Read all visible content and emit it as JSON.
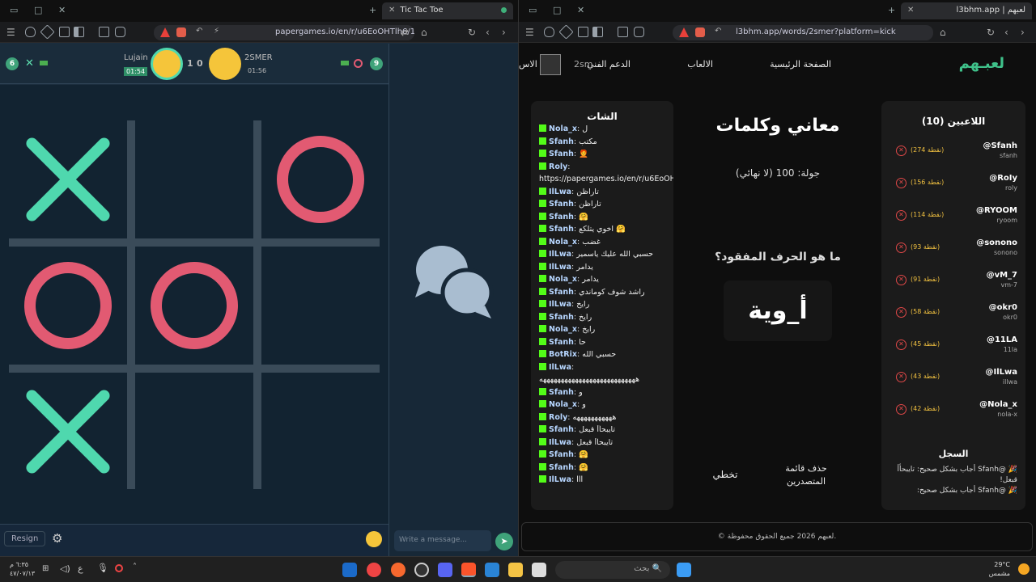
{
  "left_window": {
    "tab_title": "Tic Tac Toe",
    "url": "papergames.io/en/r/u6EoOHTlh6/1",
    "players": {
      "left_name": "Lujain",
      "left_timer": "01:54",
      "left_score": "1",
      "right_name": "2SMER",
      "right_timer": "01:56",
      "right_score": "0",
      "left_badge": "6",
      "right_badge": "9"
    },
    "board": [
      "X",
      "",
      "O",
      "O",
      "O",
      "",
      "X",
      "",
      ""
    ],
    "resign_label": "Resign",
    "chat_placeholder": "Write a message..."
  },
  "right_window": {
    "tab_title": "l3bhm.app | لعبهم",
    "url": "l3bhm.app/words/2smer?platform=kick",
    "logo": "لعبـهم",
    "nav": [
      "الصفحة الرئيسية",
      "الالعاب",
      "الدعم الفني",
      "2sm",
      "الاس"
    ],
    "chat_title": "الشات",
    "chat": [
      {
        "u": "Nola_x",
        "m": "ل"
      },
      {
        "u": "Sfanh",
        "m": "مكتب"
      },
      {
        "u": "Sfanh",
        "m": "🧑‍🦰"
      },
      {
        "u": "Roly",
        "m": ""
      },
      {
        "u": "",
        "m": "https://papergames.io/en/r/u6EoOH"
      },
      {
        "u": "IlLwa",
        "m": "تاراظن"
      },
      {
        "u": "Sfanh",
        "m": "تاراظن"
      },
      {
        "u": "Sfanh",
        "m": "🤗"
      },
      {
        "u": "Sfanh",
        "m": "اخوي يتلكع 🤗"
      },
      {
        "u": "Nola_x",
        "m": "غضب"
      },
      {
        "u": "IlLwa",
        "m": "حسبي الله عليك ياسمير"
      },
      {
        "u": "IlLwa",
        "m": "يدامر"
      },
      {
        "u": "Nola_x",
        "m": "يدامر"
      },
      {
        "u": "Sfanh",
        "m": "راشد شوف كوماندي"
      },
      {
        "u": "IlLwa",
        "m": "رايخ"
      },
      {
        "u": "Sfanh",
        "m": "رايخ"
      },
      {
        "u": "Nola_x",
        "m": "رايخ"
      },
      {
        "u": "Sfanh",
        "m": "حا"
      },
      {
        "u": "BotRix",
        "m": "حسبي الله"
      },
      {
        "u": "IlLwa",
        "m": ""
      },
      {
        "u": "",
        "m": "هههههههههههههههههههههههههههه"
      },
      {
        "u": "Sfanh",
        "m": "و"
      },
      {
        "u": "Nola_x",
        "m": "و"
      },
      {
        "u": "Roly",
        "m": "هههههههههههه"
      },
      {
        "u": "Sfanh",
        "m": "تايبحأأ قبعل"
      },
      {
        "u": "IlLwa",
        "m": "تايبحأأ قبعل"
      },
      {
        "u": "Sfanh",
        "m": "🤗"
      },
      {
        "u": "Sfanh",
        "m": "🤗"
      },
      {
        "u": "IlLwa",
        "m": "lll"
      }
    ],
    "game_title": "معاني وكلمات",
    "round": "جولة: 100 (لا نهائي)",
    "question": "ما هو الحرف المفقود؟",
    "puzzle": "أ_وية",
    "btn_delete": "حذف قائمة المتصدرين",
    "btn_skip": "تخطي",
    "players_title": "اللاعبين (10)",
    "players": [
      {
        "n": "@Sfanh",
        "h": "sfanh",
        "p": "(274 نقطة)"
      },
      {
        "n": "@RoIy",
        "h": "roly",
        "p": "(156 نقطة)"
      },
      {
        "n": "@RYOOM",
        "h": "ryoom",
        "p": "(114 نقطة)"
      },
      {
        "n": "@sonono",
        "h": "sonono",
        "p": "(93 نقطة)"
      },
      {
        "n": "@vM_7",
        "h": "vm-7",
        "p": "(91 نقطة)"
      },
      {
        "n": "@okr0",
        "h": "okr0",
        "p": "(58 نقطة)"
      },
      {
        "n": "@11LA",
        "h": "11la",
        "p": "(45 نقطة)"
      },
      {
        "n": "@IlLwa",
        "h": "illwa",
        "p": "(43 نقطة)"
      },
      {
        "n": "@Nola_x",
        "h": "nola-x",
        "p": "(42 نقطة)"
      }
    ],
    "log_title": "السجل",
    "log": [
      "🎉 @Sfanh أجاب بشكل صحيح: تايبحأأ قبعل!",
      "🎉 @Sfanh أجاب بشكل صحيح:"
    ],
    "footer": "© لعبهم 2026 جميع الحقوق محفوظة."
  },
  "taskbar": {
    "search": "بحث",
    "time": "٦:٣٥ م",
    "date": "٤٧/٠٧/١٣",
    "weather_temp": "29°C",
    "weather_text": "مشمس",
    "lang": "ع"
  }
}
